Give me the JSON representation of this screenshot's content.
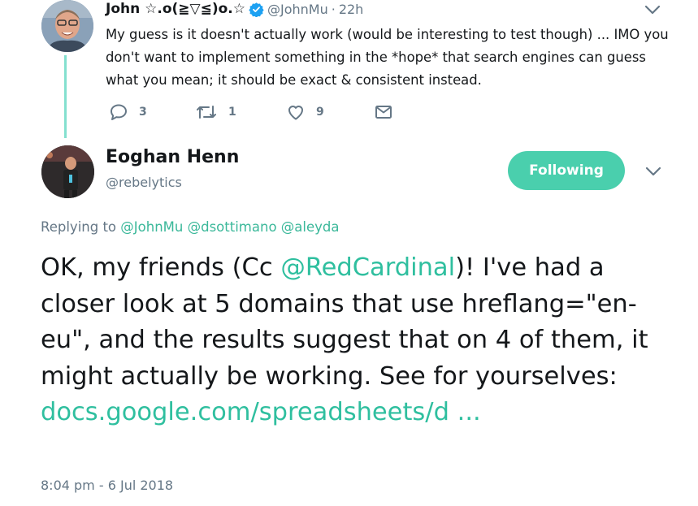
{
  "colors": {
    "accent": "#4acfad",
    "link": "#2fbf9f",
    "muted": "#657786",
    "text": "#14171a",
    "thread_line": "#84e0cf",
    "verified": "#1da1f2"
  },
  "tweet1": {
    "author_name": "John ☆.o(≧▽≦)o.☆",
    "handle": "@JohnMu",
    "separator": "·",
    "time": "22h",
    "text": "My guess is it doesn't actually work (would be interesting to test though) ... IMO you don't want to implement something in the *hope* that search engines can guess what you mean; it should be exact & consistent instead.",
    "actions": {
      "reply_count": "3",
      "retweet_count": "1",
      "like_count": "9"
    },
    "icons": [
      "verified-badge-icon",
      "chevron-down-icon",
      "reply-icon",
      "retweet-icon",
      "like-icon",
      "direct-message-icon"
    ]
  },
  "tweet2": {
    "author_name": "Eoghan Henn",
    "handle": "@rebelytics",
    "follow_label": "Following",
    "replying_prefix": "Replying to",
    "replying_to": [
      "@JohnMu",
      "@dsottimano",
      "@aleyda"
    ],
    "text_parts": {
      "p1": "OK, my friends (Cc ",
      "mention": "@RedCardinal",
      "p2": ")! I've had a closer look at 5 domains that use hreflang=\"en-eu\", and the results suggest that on 4 of them, it might actually be working. See for yourselves: ",
      "link": "docs.google.com/spreadsheets/d  ..."
    },
    "timestamp": "8:04 pm - 6 Jul 2018"
  }
}
